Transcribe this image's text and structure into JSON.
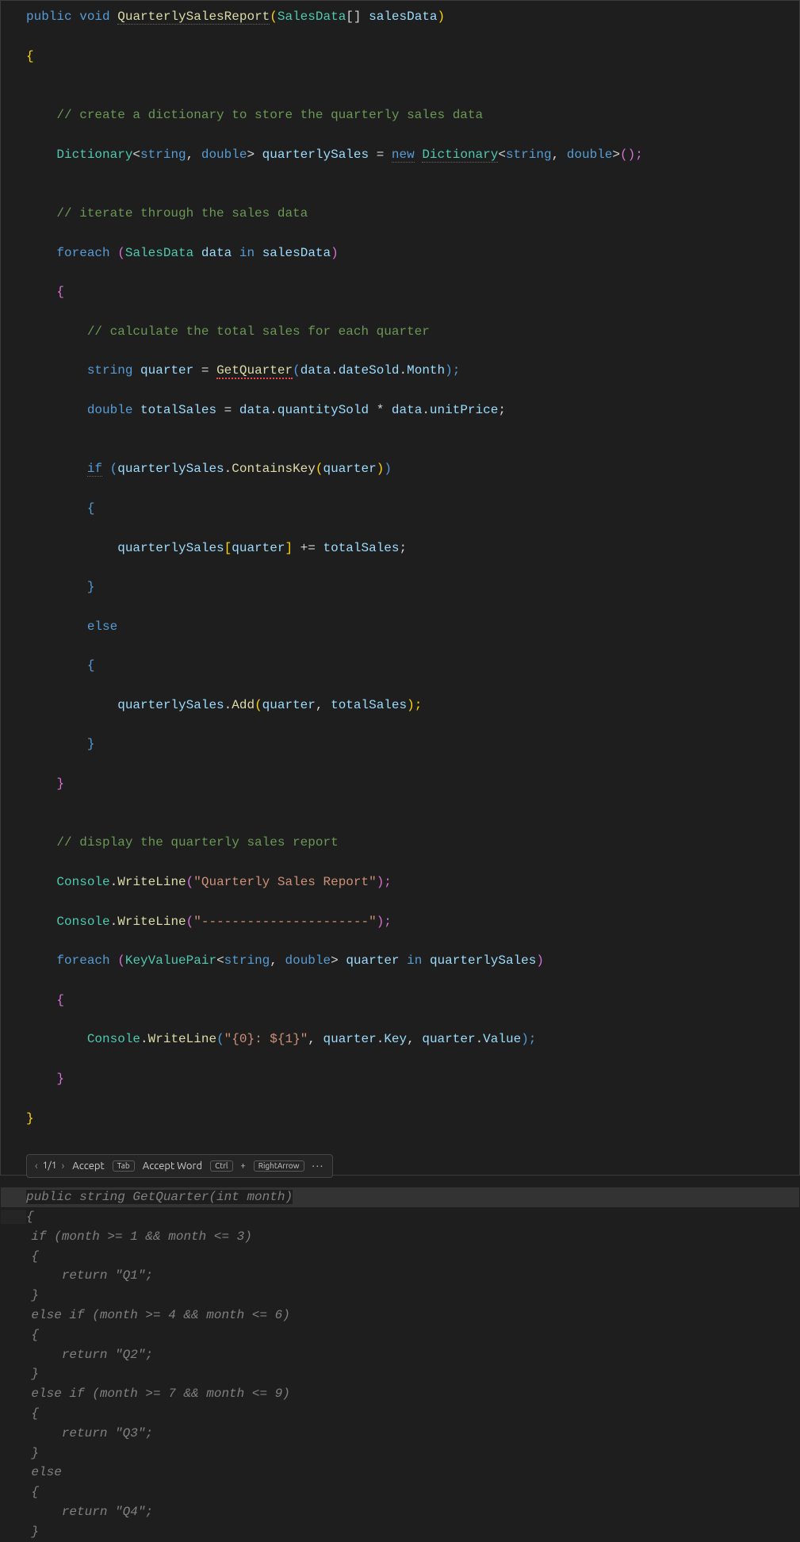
{
  "code": {
    "l1": {
      "public": "public",
      "void": "void",
      "method": "QuarterlySalesReport",
      "lp": "(",
      "type": "SalesData",
      "arr": "[]",
      "sp": " ",
      "param": "salesData",
      "rp": ")"
    },
    "l2": "{",
    "c1": "// create a dictionary to store the quarterly sales data",
    "l3": {
      "type": "Dictionary",
      "lt": "<",
      "t1": "string",
      "comma": ", ",
      "t2": "double",
      "gt": ">",
      "sp": " ",
      "var": "quarterlySales",
      "eq": " = ",
      "new": "new",
      "sp2": " ",
      "type2": "Dictionary",
      "lt2": "<",
      "t3": "string",
      "comma2": ", ",
      "t4": "double",
      "gt2": ">",
      "paren": "();"
    },
    "c2": "// iterate through the sales data",
    "l4": {
      "foreach": "foreach",
      "sp": " ",
      "lp": "(",
      "type": "SalesData",
      "sp2": " ",
      "var": "data",
      "sp3": " ",
      "in": "in",
      "sp4": " ",
      "coll": "salesData",
      "rp": ")"
    },
    "l5": "{",
    "c3": "// calculate the total sales for each quarter",
    "l6": {
      "type": "string",
      "sp": " ",
      "var": "quarter",
      "eq": " = ",
      "method": "GetQuarter",
      "lp": "(",
      "obj": "data",
      "dot": ".",
      "prop": "dateSold",
      "dot2": ".",
      "prop2": "Month",
      "rp": ");"
    },
    "l7": {
      "type": "double",
      "sp": " ",
      "var": "totalSales",
      "eq": " = ",
      "obj": "data",
      "dot": ".",
      "prop": "quantitySold",
      "op": " * ",
      "obj2": "data",
      "dot2": ".",
      "prop2": "unitPrice",
      "end": ";"
    },
    "l8": {
      "if": "if",
      "sp": " ",
      "lp": "(",
      "obj": "quarterlySales",
      "dot": ".",
      "method": "ContainsKey",
      "lp2": "(",
      "arg": "quarter",
      "rp2": ")",
      "rp": ")"
    },
    "l9": "{",
    "l10": {
      "obj": "quarterlySales",
      "lb": "[",
      "key": "quarter",
      "rb": "]",
      "op": " += ",
      "val": "totalSales",
      "end": ";"
    },
    "l11": "}",
    "l12": "else",
    "l13": "{",
    "l14": {
      "obj": "quarterlySales",
      "dot": ".",
      "method": "Add",
      "lp": "(",
      "a1": "quarter",
      "comma": ", ",
      "a2": "totalSales",
      "rp": ");"
    },
    "l15": "}",
    "l16": "}",
    "c4": "// display the quarterly sales report",
    "l17": {
      "cls": "Console",
      "dot": ".",
      "method": "WriteLine",
      "lp": "(",
      "str": "\"Quarterly Sales Report\"",
      "rp": ");"
    },
    "l18": {
      "cls": "Console",
      "dot": ".",
      "method": "WriteLine",
      "lp": "(",
      "str": "\"----------------------\"",
      "rp": ");"
    },
    "l19": {
      "foreach": "foreach",
      "sp": " ",
      "lp": "(",
      "type": "KeyValuePair",
      "lt": "<",
      "t1": "string",
      "comma": ", ",
      "t2": "double",
      "gt": ">",
      "sp2": " ",
      "var": "quarter",
      "sp3": " ",
      "in": "in",
      "sp4": " ",
      "coll": "quarterlySales",
      "rp": ")"
    },
    "l20": "{",
    "l21": {
      "cls": "Console",
      "dot": ".",
      "method": "WriteLine",
      "lp": "(",
      "str": "\"{0}: ${1}\"",
      "comma": ", ",
      "a1": "quarter",
      "dot2": ".",
      "p1": "Key",
      "comma2": ", ",
      "a2": "quarter",
      "dot3": ".",
      "p2": "Value",
      "rp": ");"
    },
    "l22": "}",
    "l23": "}"
  },
  "suggest_bar": {
    "prev": "‹",
    "count": "1/1",
    "next": "›",
    "accept": "Accept",
    "accept_key": "Tab",
    "accept_word": "Accept Word",
    "ctrl": "Ctrl",
    "plus": "+",
    "right": "RightArrow",
    "more": "···"
  },
  "ghost": {
    "l1": "public string GetQuarter(int month)",
    "l2": "{",
    "l3": "    if (month >= 1 && month <= 3)",
    "l4": "    {",
    "l5": "        return \"Q1\";",
    "l6": "    }",
    "l7": "    else if (month >= 4 && month <= 6)",
    "l8": "    {",
    "l9": "        return \"Q2\";",
    "l10": "    }",
    "l11": "    else if (month >= 7 && month <= 9)",
    "l12": "    {",
    "l13": "        return \"Q3\";",
    "l14": "    }",
    "l15": "    else",
    "l16": "    {",
    "l17": "        return \"Q4\";",
    "l18": "    }"
  }
}
